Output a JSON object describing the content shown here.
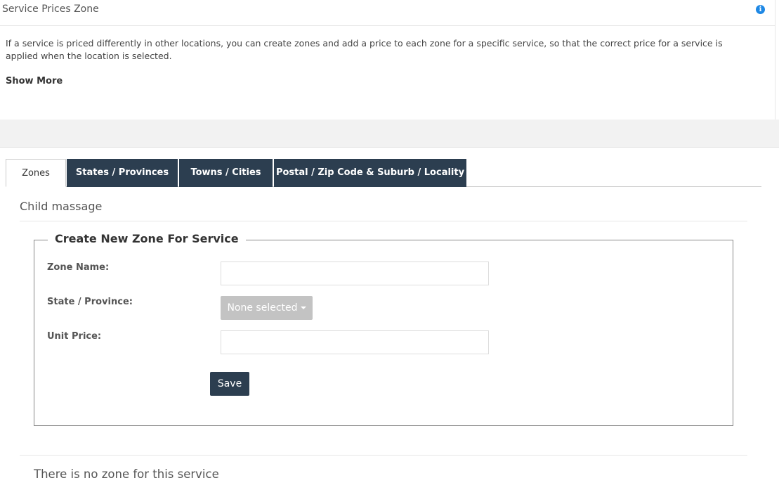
{
  "panel": {
    "title": "Service Prices Zone",
    "info_icon": "info-circle-icon",
    "description": "If a service is priced differently in other locations, you can create zones and add a price to each zone for a specific service, so that the correct price for a service is applied when the location is selected.",
    "show_more": "Show More"
  },
  "tabs": [
    {
      "label": "Zones",
      "active": true
    },
    {
      "label": "States / Provinces",
      "active": false
    },
    {
      "label": "Towns / Cities",
      "active": false
    },
    {
      "label": "Postal / Zip Code & Suburb / Locality",
      "active": false
    }
  ],
  "service": {
    "name": "Child massage"
  },
  "form": {
    "legend": "Create New Zone For Service",
    "zone_name_label": "Zone Name:",
    "zone_name_value": "",
    "state_label": "State / Province:",
    "state_selected": "None selected",
    "unit_price_label": "Unit Price:",
    "unit_price_value": "",
    "save_label": "Save"
  },
  "zones": {
    "empty_message": "There is no zone for this service"
  },
  "colors": {
    "dark_navy": "#2c3e50",
    "info_blue": "#1e88e5",
    "disabled_gray": "#c3c3c3",
    "band_gray": "#f2f2f2"
  }
}
